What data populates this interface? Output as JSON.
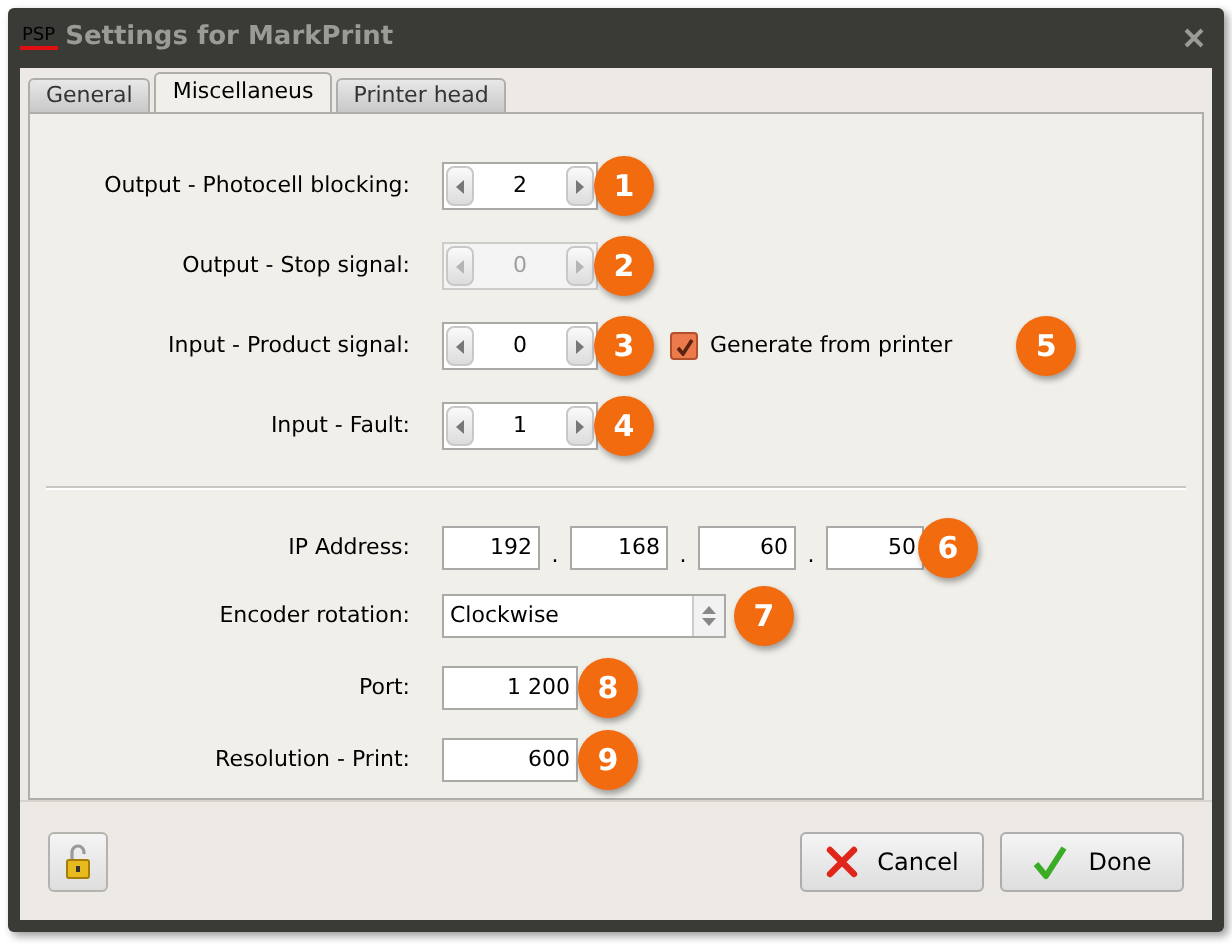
{
  "window": {
    "title": "Settings for MarkPrint",
    "logo": "PSP"
  },
  "tabs": [
    {
      "label": "General",
      "selected": false
    },
    {
      "label": "Miscellaneus",
      "selected": true
    },
    {
      "label": "Printer head",
      "selected": false
    }
  ],
  "spinners": [
    {
      "label": "Output - Photocell blocking:",
      "value": "2",
      "disabled": false,
      "callout": "1"
    },
    {
      "label": "Output - Stop signal:",
      "value": "0",
      "disabled": true,
      "callout": "2"
    },
    {
      "label": "Input - Product signal:",
      "value": "0",
      "disabled": false,
      "callout": "3",
      "checkbox": {
        "label": "Generate from printer",
        "checked": true,
        "callout": "5"
      }
    },
    {
      "label": "Input - Fault:",
      "value": "1",
      "disabled": false,
      "callout": "4"
    }
  ],
  "ip": {
    "label": "IP Address:",
    "octets": [
      "192",
      "168",
      "60",
      "50"
    ],
    "separator": ".",
    "callout": "6"
  },
  "encoder": {
    "label": "Encoder rotation:",
    "value": "Clockwise",
    "callout": "7"
  },
  "fields": [
    {
      "label": "Port:",
      "value": "1 200",
      "callout": "8"
    },
    {
      "label": "Resolution - Print:",
      "value": "600",
      "callout": "9"
    }
  ],
  "buttons": [
    {
      "label": "Cancel",
      "kind": "cancel"
    },
    {
      "label": "Done",
      "kind": "done"
    }
  ]
}
